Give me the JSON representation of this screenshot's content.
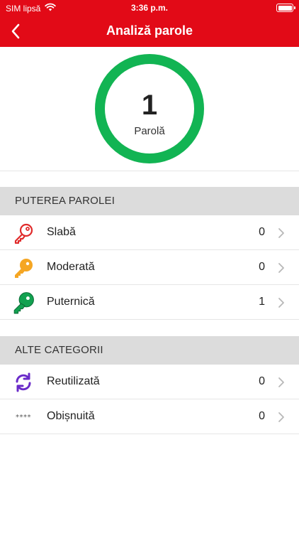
{
  "status_bar": {
    "carrier": "SIM lipsă",
    "time": "3:36 p.m.",
    "wifi_icon": "wifi-icon",
    "battery_icon": "battery-full-icon"
  },
  "nav": {
    "title": "Analiză parole",
    "back_icon": "chevron-left-icon"
  },
  "summary": {
    "count": "1",
    "label": "Parolă",
    "ring_color": "#12b453"
  },
  "strength_section": {
    "title": "PUTEREA PAROLEI",
    "items": [
      {
        "label": "Slabă",
        "count": "0",
        "icon": "key-weak-icon",
        "color": "#e02b2b"
      },
      {
        "label": "Moderată",
        "count": "0",
        "icon": "key-moderate-icon",
        "color": "#f5a623"
      },
      {
        "label": "Puternică",
        "count": "1",
        "icon": "key-strong-icon",
        "color": "#12a150"
      }
    ]
  },
  "other_section": {
    "title": "ALTE CATEGORII",
    "items": [
      {
        "label": "Reutilizată",
        "count": "0",
        "icon": "refresh-icon",
        "color": "#6a2bc9"
      },
      {
        "label": "Obișnuită",
        "count": "0",
        "icon": "asterisks-icon",
        "glyph": "****"
      }
    ]
  },
  "colors": {
    "header": "#e20a17",
    "section_bg": "#dcdcdc"
  }
}
